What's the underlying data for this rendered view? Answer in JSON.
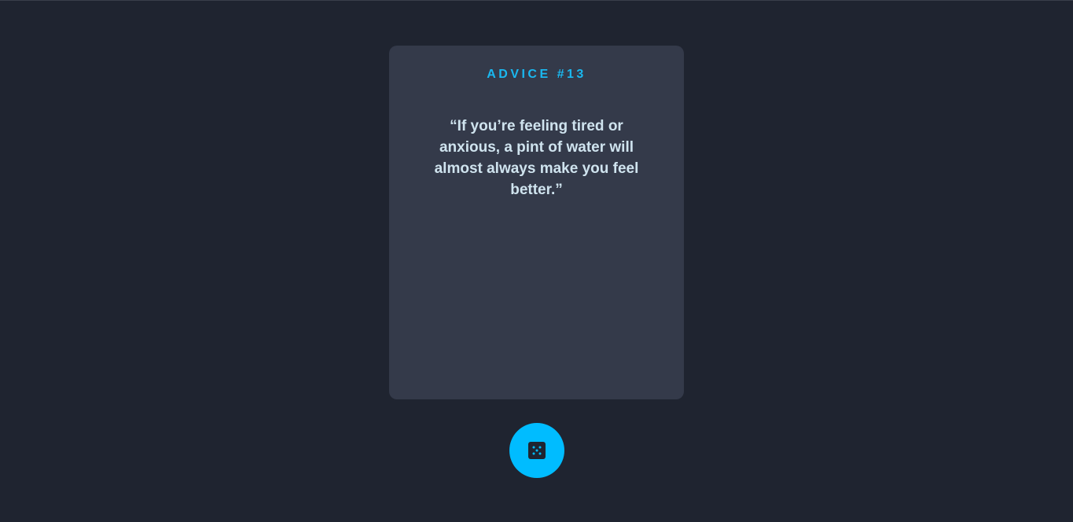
{
  "card": {
    "advice_label": "ADVICE #13",
    "advice_text": "“If you’re feeling tired or anxious, a pint of water will almost always make you feel better.”"
  },
  "dice_button": {
    "icon": "dice-icon"
  },
  "colors": {
    "background": "#1f2430",
    "card": "#343a4a",
    "accent": "#1ab8f0",
    "button": "#00bcff",
    "text": "#cfe3ee"
  }
}
